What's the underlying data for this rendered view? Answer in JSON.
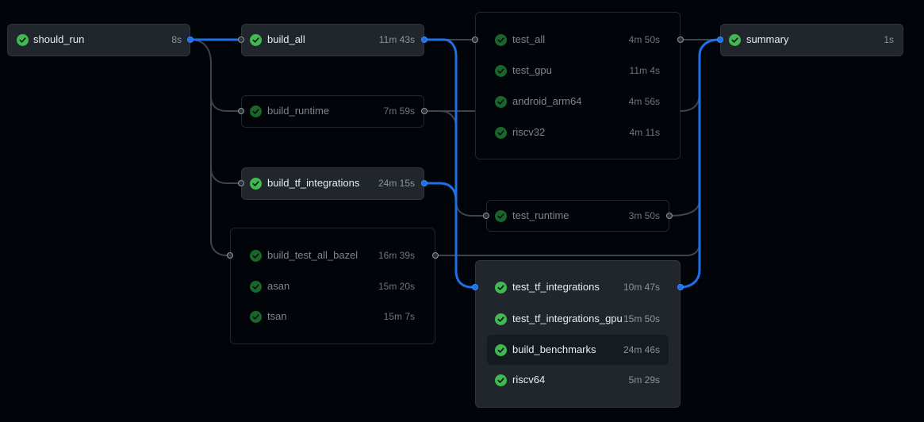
{
  "graph": {
    "jobs": {
      "should_run": {
        "name": "should_run",
        "duration": "8s"
      },
      "build_all": {
        "name": "build_all",
        "duration": "11m 43s"
      },
      "build_runtime": {
        "name": "build_runtime",
        "duration": "7m 59s"
      },
      "build_tf_integrations": {
        "name": "build_tf_integrations",
        "duration": "24m 15s"
      },
      "build_test_all_bazel": {
        "name": "build_test_all_bazel",
        "duration": "16m 39s"
      },
      "asan": {
        "name": "asan",
        "duration": "15m 20s"
      },
      "tsan": {
        "name": "tsan",
        "duration": "15m 7s"
      },
      "test_all": {
        "name": "test_all",
        "duration": "4m 50s"
      },
      "test_gpu": {
        "name": "test_gpu",
        "duration": "11m 4s"
      },
      "android_arm64": {
        "name": "android_arm64",
        "duration": "4m 56s"
      },
      "riscv32": {
        "name": "riscv32",
        "duration": "4m 11s"
      },
      "test_runtime": {
        "name": "test_runtime",
        "duration": "3m 50s"
      },
      "test_tf_integrations": {
        "name": "test_tf_integrations",
        "duration": "10m 47s"
      },
      "test_tf_integrations_gpu": {
        "name": "test_tf_integrations_gpu",
        "duration": "15m 50s"
      },
      "build_benchmarks": {
        "name": "build_benchmarks",
        "duration": "24m 46s"
      },
      "riscv64": {
        "name": "riscv64",
        "duration": "5m 29s"
      },
      "summary": {
        "name": "summary",
        "duration": "1s"
      }
    },
    "status_icon": "check-circle-icon",
    "colors": {
      "background": "#010409",
      "node_bright": "#21262d",
      "success": "#3fb950",
      "edge_highlight": "#1f6feb",
      "edge_default": "#3d444d"
    }
  }
}
